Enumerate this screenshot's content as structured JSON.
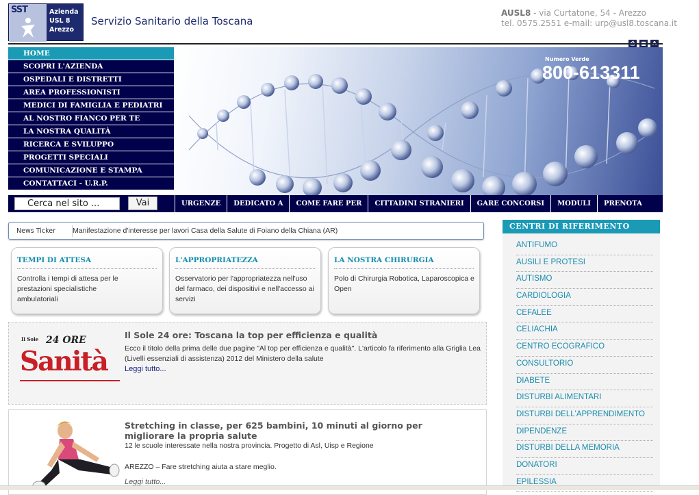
{
  "header": {
    "logo": {
      "mark": "SST",
      "line1": "Azienda",
      "line2": "USL 8",
      "line3": "Arezzo"
    },
    "site_title": "Servizio Sanitario della Toscana",
    "contact_org": "AUSL8",
    "contact_address": " - via Curtatone, 54 - Arezzo",
    "contact_line2": "tel. 0575.2551 e-mail: urp@usl8.toscana.it",
    "tools": [
      "print-icon",
      "text-small-icon",
      "text-large-icon"
    ],
    "tool_glyph": "A"
  },
  "menu": {
    "items": [
      "HOME",
      "SCOPRI L'AZIENDA",
      "OSPEDALI E DISTRETTI",
      "AREA PROFESSIONISTI",
      "MEDICI DI FAMIGLIA E PEDIATRI",
      "AL NOSTRO FIANCO PER TE",
      "LA NOSTRA QUALITÀ",
      "RICERCA E SVILUPPO",
      "PROGETTI SPECIALI",
      "COMUNICAZIONE E STAMPA",
      "CONTATTACI - U.R.P."
    ]
  },
  "banner": {
    "label": "Numero Verde",
    "number": "800-613311"
  },
  "search": {
    "value": "Cerca nel sito ...",
    "button": "Vai"
  },
  "nav": {
    "items": [
      "URGENZE",
      "DEDICATO A",
      "COME FARE PER",
      "CITTADINI STRANIERI",
      "GARE CONCORSI",
      "MODULI",
      "PRENOTA"
    ]
  },
  "ticker": {
    "label": "News Ticker",
    "message": "Manifestazione d'interesse per lavori Casa della Salute di Foiano della Chiana (AR)"
  },
  "boxes": [
    {
      "title": "TEMPI DI ATTESA",
      "body": "Controlla i tempi di attesa per le prestazioni specialistiche ambulatoriali"
    },
    {
      "title": "L'APPROPRIATEZZA",
      "body": "Osservatorio per l'appropriatezza nell'uso del farmaco, dei dispositivi e nell'accesso ai servizi"
    },
    {
      "title": "LA NOSTRA CHIRURGIA",
      "body": "Polo di Chirurgia Robotica, Laparoscopica e Open"
    }
  ],
  "news": [
    {
      "logo_small": "Il Sole",
      "logo_24": "24 ORE",
      "logo_word": "Sanità",
      "title": "Il Sole 24 ore: Toscana la top per efficienza e qualità",
      "text": "Ecco il titolo della prima delle due pagine \"Al top per efficienza e qualità\". L'articolo fa riferimento alla Griglia Lea (Livelli essenziali di assistenza) 2012 del Ministero della salute",
      "more": "Leggi tutto..."
    },
    {
      "title": "Stretching in classe, per 625 bambini, 10 minuti al giorno per migliorare la propria salute",
      "text": "12 le scuole interessate nella nostra provincia. Progetto di Asl, Uisp e Regione",
      "text2": "AREZZO – Fare stretching  aiuta a stare meglio.",
      "more": "Leggi tutto..."
    }
  ],
  "right_column": {
    "title": "CENTRI DI RIFERIMENTO",
    "items": [
      "ANTIFUMO",
      "AUSILI E PROTESI",
      "AUTISMO",
      "CARDIOLOGIA",
      "CEFALEE",
      "CELIACHIA",
      "CENTRO ECOGRAFICO",
      "CONSULTORIO",
      "DIABETE",
      "DISTURBI ALIMENTARI",
      "DISTURBI DELL'APPRENDIMENTO",
      "DIPENDENZE",
      "DISTURBI DELLA MEMORIA",
      "DONATORI",
      "EPILESSIA"
    ]
  },
  "colors": {
    "navy": "#01004a",
    "teal": "#1b9ab6",
    "link_blue": "#1a8cae",
    "red": "#c91f26"
  }
}
